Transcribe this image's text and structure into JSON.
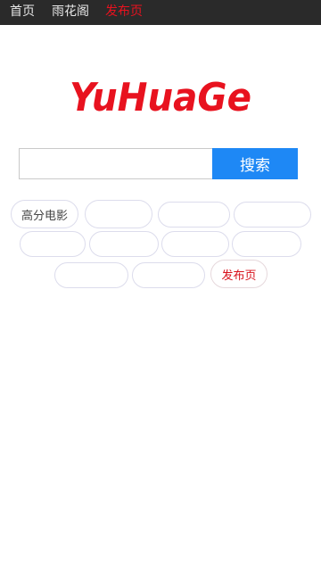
{
  "nav": {
    "items": [
      {
        "label": "首页",
        "active": false
      },
      {
        "label": "雨花阁",
        "active": false
      },
      {
        "label": "发布页",
        "active": true
      }
    ]
  },
  "logo": {
    "text": "YuHuaGe",
    "color": "#e8121f"
  },
  "search": {
    "value": "",
    "placeholder": "",
    "button_label": "搜索"
  },
  "tags": [
    {
      "label": "高分电影",
      "style": "normal"
    },
    {
      "label": "",
      "style": "faint"
    },
    {
      "label": "",
      "style": "faint"
    },
    {
      "label": "",
      "style": "faint"
    },
    {
      "label": "",
      "style": "faint"
    },
    {
      "label": "",
      "style": "faint"
    },
    {
      "label": "",
      "style": "faint"
    },
    {
      "label": "",
      "style": "faint"
    },
    {
      "label": "",
      "style": "faint"
    },
    {
      "label": "",
      "style": "faint"
    },
    {
      "label": "发布页",
      "style": "red"
    }
  ],
  "colors": {
    "nav_bg": "#2a2a2a",
    "accent_red": "#e8121f",
    "search_button": "#1e88f5"
  }
}
